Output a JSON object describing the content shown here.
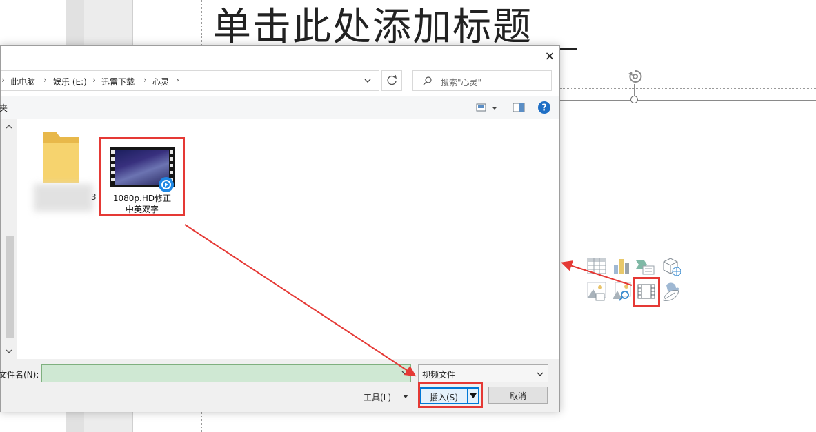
{
  "background": {
    "slide_title": "单击此处添加标题"
  },
  "dialog": {
    "close_glyph": "×",
    "breadcrumb": [
      "此电脑",
      "娱乐 (E:)",
      "迅雷下载",
      "心灵"
    ],
    "search_placeholder": "搜索\"心灵\"",
    "toolbar_label": "夹",
    "files": [
      {
        "name": "1080p.HD修正中英双字",
        "name_line1": "1080p.HD修正",
        "name_line2": "中英双字",
        "type": "video"
      }
    ],
    "folder_label_tail": "3",
    "filename_label": "文件名(N):",
    "filename_value": "",
    "filetype_value": "视频文件",
    "tools_label": "工具(L)",
    "insert_label": "插入(S)",
    "cancel_label": "取消"
  },
  "colors": {
    "highlight": "#e53935",
    "accent": "#0078d7",
    "filename_bg": "#cfe8d3"
  },
  "icons": [
    "table-icon",
    "chart-icon",
    "smartart-icon",
    "3d-model-icon",
    "picture-icon",
    "online-picture-icon",
    "video-icon",
    "icon-insert-icon"
  ]
}
